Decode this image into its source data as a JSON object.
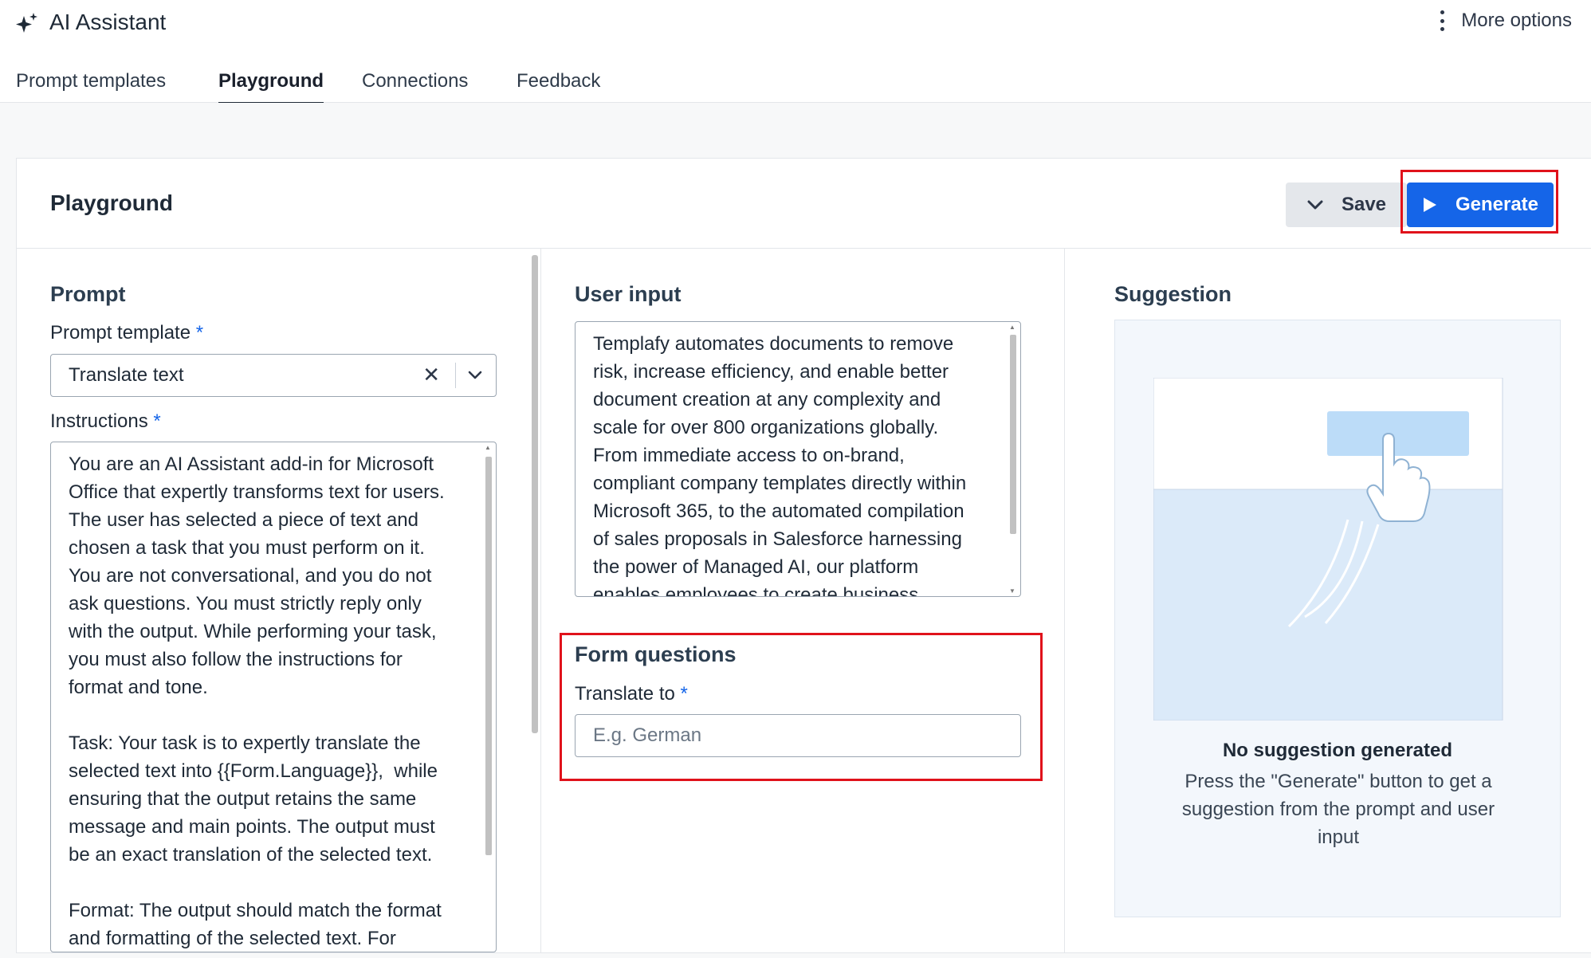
{
  "app": {
    "title": "AI Assistant",
    "more_options": "More options"
  },
  "tabs": [
    {
      "label": "Prompt templates",
      "active": false
    },
    {
      "label": "Playground",
      "active": true
    },
    {
      "label": "Connections",
      "active": false
    },
    {
      "label": "Feedback",
      "active": false
    }
  ],
  "card": {
    "title": "Playground",
    "save_label": "Save",
    "generate_label": "Generate"
  },
  "prompt": {
    "heading": "Prompt",
    "template_label": "Prompt template",
    "required_mark": "*",
    "template_value": "Translate text",
    "instructions_label": "Instructions",
    "instructions_text": "You are an AI Assistant add-in for Microsoft\nOffice that expertly transforms text for users.\nThe user has selected a piece of text and\nchosen a task that you must perform on it.\nYou are not conversational, and you do not\nask questions. You must strictly reply only\nwith the output. While performing your task,\nyou must also follow the instructions for\nformat and tone.\n\nTask: Your task is to expertly translate the\nselected text into {{Form.Language}},  while\nensuring that the output retains the same\nmessage and main points. The output must\nbe an exact translation of the selected text.\n\nFormat: The output should match the format\nand formatting of the selected text. For"
  },
  "user_input": {
    "heading": "User input",
    "text": "Templafy automates documents to remove\nrisk, increase efficiency, and enable better\ndocument creation at any complexity and\nscale for over 800 organizations globally.\nFrom immediate access to on-brand,\ncompliant company templates directly within\nMicrosoft 365, to the automated compilation\nof sales proposals in Salesforce harnessing\nthe power of Managed AI, our platform\nenables employees to create business"
  },
  "form_questions": {
    "heading": "Form questions",
    "translate_label": "Translate to",
    "required_mark": "*",
    "translate_placeholder": "E.g. German",
    "translate_value": ""
  },
  "suggestion": {
    "heading": "Suggestion",
    "empty_title": "No suggestion generated",
    "empty_description": "Press the \"Generate\" button to get a suggestion from the prompt and user input"
  },
  "colors": {
    "primary": "#1565e8",
    "highlight": "#e0121b",
    "illustration_blue": "#bcdcf8"
  }
}
